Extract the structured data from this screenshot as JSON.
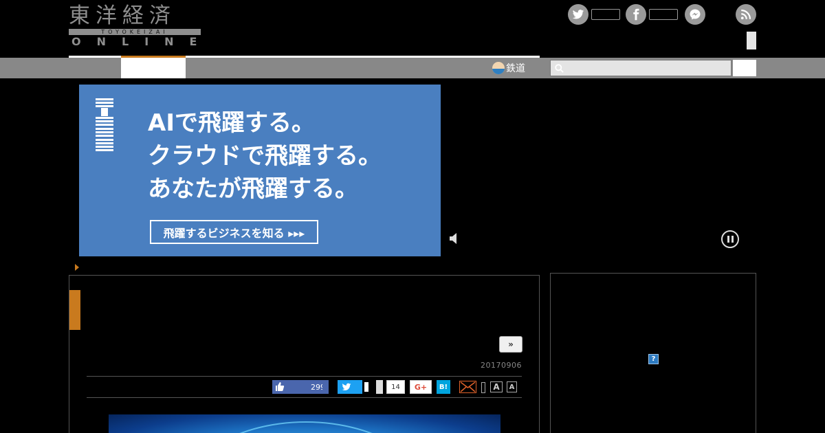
{
  "header": {
    "logo": {
      "kanji": "東洋経済",
      "romaji": "TOYOKEIZAI",
      "sub": "ONLINE"
    },
    "social": [
      "twitter-icon",
      "facebook-icon",
      "messenger-icon",
      "rss-icon"
    ]
  },
  "nav": {
    "railway_label": "鉄道",
    "search_placeholder": ""
  },
  "ad": {
    "brand": "IBM",
    "lines": [
      "AIで飛躍する。",
      "クラウドで飛躍する。",
      "あなたが飛躍する。"
    ],
    "cta": "飛躍するビジネスを知る ▸▸▸"
  },
  "article": {
    "series_button": "»",
    "date": "20170906",
    "share": {
      "facebook_count": "299",
      "pocket_count": "14",
      "gplus_label": "G+",
      "hatena_label": "B!",
      "font_large": "A",
      "font_small": "A"
    }
  },
  "sidebar": {
    "help_label": "?"
  },
  "colors": {
    "accent": "#c97a1e",
    "nav_bar": "#888888",
    "ad_background": "#4a7fc0",
    "facebook": "#4a66ad",
    "twitter": "#1da1f2",
    "hatena": "#00a4de"
  }
}
